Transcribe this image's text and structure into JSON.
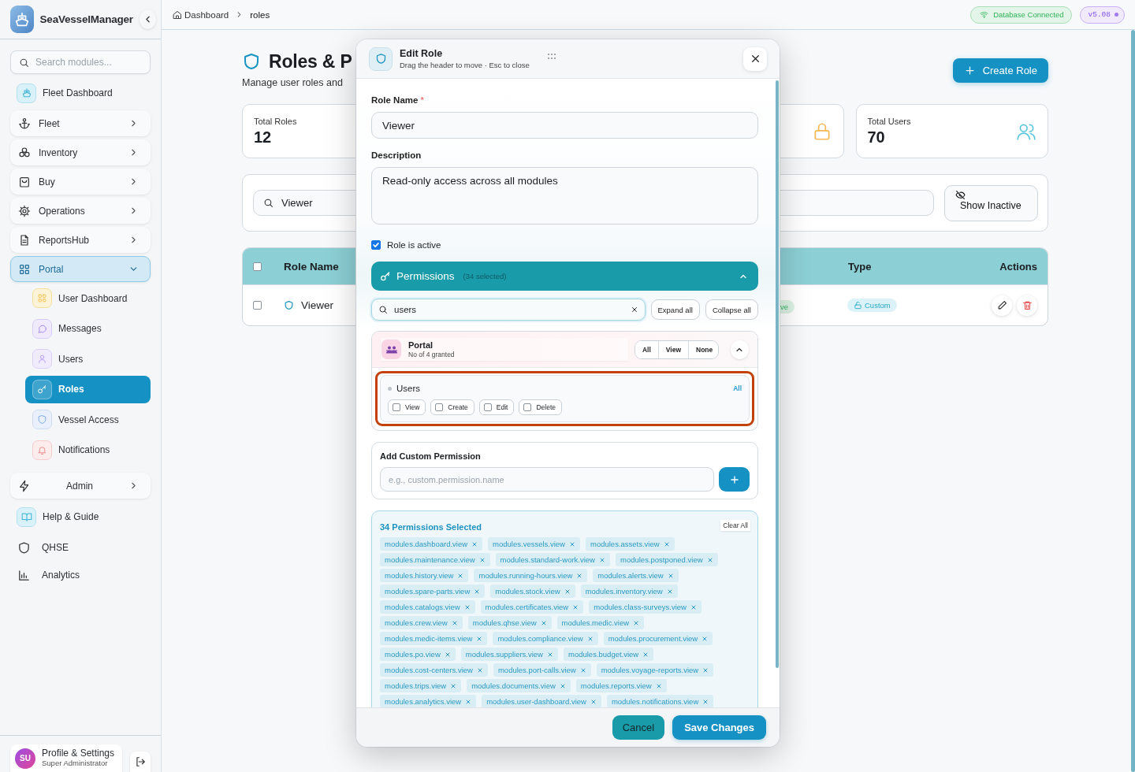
{
  "sidebar": {
    "brand": "SeaVesselManager",
    "search": {
      "placeholder": "Search modules..."
    },
    "items": [
      {
        "label": "Fleet Dashboard",
        "kind": "link",
        "selected": false
      },
      {
        "label": "Fleet",
        "kind": "group",
        "expanded": false
      },
      {
        "label": "Inventory",
        "kind": "group",
        "expanded": false
      },
      {
        "label": "Buy",
        "kind": "group",
        "expanded": false
      },
      {
        "label": "Operations",
        "kind": "group",
        "expanded": false
      },
      {
        "label": "ReportsHub",
        "kind": "group",
        "expanded": false
      },
      {
        "label": "Portal",
        "kind": "group",
        "expanded": true,
        "children": [
          {
            "label": "User Dashboard",
            "selected": false
          },
          {
            "label": "Messages",
            "selected": false
          },
          {
            "label": "Users",
            "selected": false
          },
          {
            "label": "Roles",
            "selected": true
          },
          {
            "label": "Vessel Access",
            "selected": false
          },
          {
            "label": "Notifications",
            "selected": false
          }
        ]
      },
      {
        "label": "Admin",
        "kind": "action",
        "expanded": false
      },
      {
        "label": "Help & Guide",
        "kind": "link",
        "selected": false
      },
      {
        "label": "QHSE",
        "kind": "plain",
        "selected": false
      },
      {
        "label": "Analytics",
        "kind": "plain",
        "selected": false
      }
    ],
    "profile": {
      "initials": "SU",
      "name": "Profile & Settings",
      "role": "Super Administrator"
    }
  },
  "topbar": {
    "breadcrumb": [
      "Dashboard",
      "roles"
    ],
    "db_status": "Database Connected",
    "version": "v5.08"
  },
  "page": {
    "title": "Roles & P",
    "subtitle": "Manage user roles and",
    "create_button": "Create Role",
    "stats": [
      {
        "kind": "count",
        "label": "Total Roles",
        "value": "12"
      },
      {
        "kind": "icon"
      },
      {
        "kind": "count",
        "label": "Total Users",
        "value": "70"
      }
    ],
    "filters": {
      "search_value": "Viewer",
      "toggle_label": "Show Inactive"
    },
    "table": {
      "header_checked": false,
      "columns": [
        "Role Name",
        "Type",
        "Actions"
      ],
      "rows": [
        {
          "checked": false,
          "name": "Viewer",
          "status": "ve",
          "type": "Custom"
        }
      ]
    }
  },
  "modal": {
    "title": "Edit Role",
    "subtitle": "Drag the header to move · Esc to close",
    "role_name": {
      "label": "Role Name",
      "required_mark": "*",
      "value": "Viewer"
    },
    "description": {
      "label": "Description",
      "value": "Read-only access across all modules"
    },
    "active": {
      "label": "Role is active",
      "checked": true
    },
    "permissions": {
      "title": "Permissions",
      "count": "(34 selected)",
      "expanded": true,
      "search": "users",
      "expand_all": "Expand all",
      "collapse_all": "Collapse all",
      "groups": [
        {
          "name": "Portal",
          "summary": "No of 4 granted",
          "expanded": true,
          "actions": [
            "All",
            "View",
            "None"
          ],
          "modules": [
            {
              "name": "Users",
              "all_label": "All",
              "highlighted": true,
              "perms": [
                {
                  "label": "View",
                  "checked": false
                },
                {
                  "label": "Create",
                  "checked": false
                },
                {
                  "label": "Edit",
                  "checked": false
                },
                {
                  "label": "Delete",
                  "checked": false
                }
              ]
            }
          ]
        }
      ]
    },
    "custom": {
      "title": "Add Custom Permission",
      "placeholder": "e.g., custom.permission.name"
    },
    "selected": {
      "title": "34 Permissions Selected",
      "clear": "Clear All",
      "tags": [
        "modules.dashboard.view",
        "modules.vessels.view",
        "modules.assets.view",
        "modules.maintenance.view",
        "modules.standard-work.view",
        "modules.postponed.view",
        "modules.history.view",
        "modules.running-hours.view",
        "modules.alerts.view",
        "modules.spare-parts.view",
        "modules.stock.view",
        "modules.inventory.view",
        "modules.catalogs.view",
        "modules.certificates.view",
        "modules.class-surveys.view",
        "modules.crew.view",
        "modules.qhse.view",
        "modules.medic.view",
        "modules.medic-items.view",
        "modules.compliance.view",
        "modules.procurement.view",
        "modules.po.view",
        "modules.suppliers.view",
        "modules.budget.view",
        "modules.cost-centers.view",
        "modules.port-calls.view",
        "modules.voyage-reports.view",
        "modules.trips.view",
        "modules.documents.view",
        "modules.reports.view",
        "modules.analytics.view",
        "modules.user-dashboard.view",
        "modules.notifications.view"
      ]
    },
    "buttons": {
      "cancel": "Cancel",
      "save": "Save Changes"
    }
  }
}
